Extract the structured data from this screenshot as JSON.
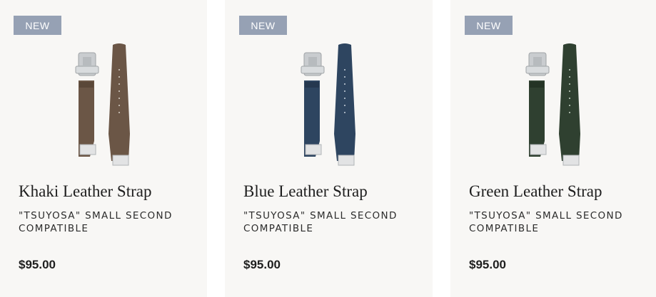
{
  "products": [
    {
      "badge": "NEW",
      "title": "Khaki Leather Strap",
      "subtitle": "\"TSUYOSA\" SMALL SECOND COMPATIBLE",
      "price": "$95.00",
      "strap_color": "#6b5646",
      "strap_color_dark": "#5a4738",
      "image_icon": "khaki-strap-image"
    },
    {
      "badge": "NEW",
      "title": "Blue Leather Strap",
      "subtitle": "\"TSUYOSA\" SMALL SECOND COMPATIBLE",
      "price": "$95.00",
      "strap_color": "#2e4560",
      "strap_color_dark": "#25384f",
      "image_icon": "blue-strap-image"
    },
    {
      "badge": "NEW",
      "title": "Green Leather Strap",
      "subtitle": "\"TSUYOSA\" SMALL SECOND COMPATIBLE",
      "price": "$95.00",
      "strap_color": "#2f4030",
      "strap_color_dark": "#243325",
      "image_icon": "green-strap-image"
    }
  ],
  "colors": {
    "card_background": "#f8f7f5",
    "badge_background": "#96a1b4",
    "text": "#1e1e1e"
  }
}
